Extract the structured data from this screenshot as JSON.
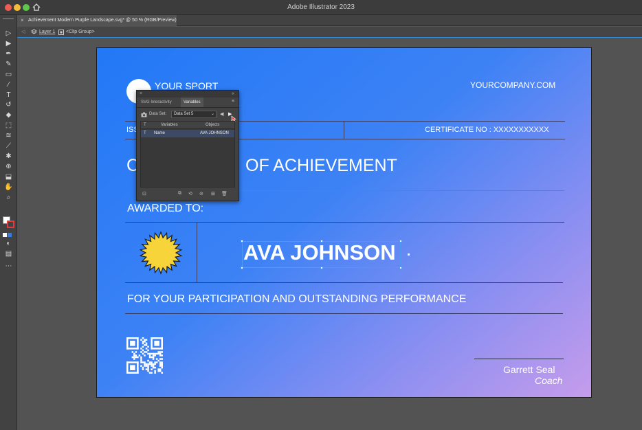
{
  "window": {
    "title": "Adobe Illustrator 2023"
  },
  "document_tab": {
    "label": "Achievement Modern Purple Landscape.svg* @ 50 % (RGB/Preview)"
  },
  "breadcrumb": {
    "layer": "Layer 1",
    "group": "<Clip Group>"
  },
  "toolbar": {
    "tools": [
      "selection-tool",
      "direct-selection-tool",
      "pen-tool",
      "curvature-tool",
      "rectangle-tool",
      "paintbrush-tool",
      "type-tool",
      "rotate-tool",
      "eraser-tool",
      "scale-tool",
      "width-tool",
      "eyedropper-tool",
      "symbol-sprayer-tool",
      "shape-builder-tool",
      "artboard-tool",
      "hand-tool",
      "zoom-tool"
    ]
  },
  "certificate": {
    "sport": "YOUR SPORT",
    "company": "YOURCOMPANY.COM",
    "issued_partial": "ISS",
    "certificate_no": "CERTIFICATE NO : XXXXXXXXXXX",
    "title_left": "C",
    "title_right": "OF ACHIEVEMENT",
    "awarded_to": "AWARDED TO:",
    "recipient": "AVA JOHNSON",
    "reason": "FOR YOUR PARTICIPATION AND OUTSTANDING PERFORMANCE",
    "signer_name": "Garrett Seal",
    "signer_role": "Coach"
  },
  "panel": {
    "tabs": [
      "SVG Interactivity",
      "Variables"
    ],
    "active_tab": "Variables",
    "dataset_label": "Data Set:",
    "dataset_value": "Data Set 5",
    "columns": [
      "Variables",
      "Objects"
    ],
    "rows": [
      {
        "type": "T",
        "variable": "Name",
        "object": "AVA JOHNSON"
      }
    ]
  },
  "colors": {
    "gradient_start": "#2278f6",
    "gradient_end": "#c69ceb",
    "seal_fill": "#f7d53a",
    "ui_dark": "#535353",
    "selection_blue": "#2e8bde"
  }
}
